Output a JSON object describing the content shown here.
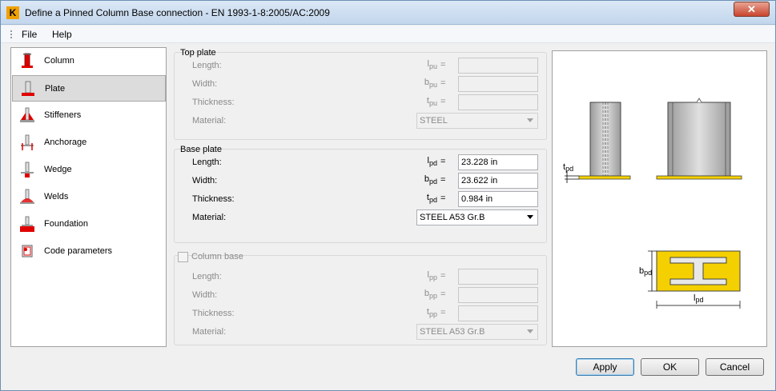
{
  "window": {
    "title": "Define a Pinned Column Base connection - EN 1993-1-8:2005/AC:2009",
    "app_icon": "K",
    "close_glyph": "✕"
  },
  "menu": {
    "file": "File",
    "help": "Help"
  },
  "nav": [
    {
      "label": "Column",
      "icon": "column-icon"
    },
    {
      "label": "Plate",
      "icon": "plate-icon",
      "selected": true
    },
    {
      "label": "Stiffeners",
      "icon": "stiffeners-icon"
    },
    {
      "label": "Anchorage",
      "icon": "anchorage-icon"
    },
    {
      "label": "Wedge",
      "icon": "wedge-icon"
    },
    {
      "label": "Welds",
      "icon": "welds-icon"
    },
    {
      "label": "Foundation",
      "icon": "foundation-icon"
    },
    {
      "label": "Code parameters",
      "icon": "code-parameters-icon"
    }
  ],
  "top_plate": {
    "title": "Top plate",
    "length_label": "Length:",
    "width_label": "Width:",
    "thickness_label": "Thickness:",
    "material_label": "Material:",
    "length_sym": "l",
    "length_sub": "pu",
    "width_sym": "b",
    "width_sub": "pu",
    "thickness_sym": "t",
    "thickness_sub": "pu",
    "eq": "=",
    "length_value": "",
    "width_value": "",
    "thickness_value": "",
    "material_value": "STEEL"
  },
  "base_plate": {
    "title": "Base plate",
    "length_label": "Length:",
    "width_label": "Width:",
    "thickness_label": "Thickness:",
    "material_label": "Material:",
    "length_sym": "l",
    "length_sub": "pd",
    "width_sym": "b",
    "width_sub": "pd",
    "thickness_sym": "t",
    "thickness_sub": "pd",
    "eq": "=",
    "length_value": "23.228 in",
    "width_value": "23.622 in",
    "thickness_value": "0.984 in",
    "material_value": "STEEL A53 Gr.B"
  },
  "column_base": {
    "title": "Column base",
    "checked": false,
    "length_label": "Length:",
    "width_label": "Width:",
    "thickness_label": "Thickness:",
    "material_label": "Material:",
    "length_sym": "l",
    "length_sub": "pp",
    "width_sym": "b",
    "width_sub": "pp",
    "thickness_sym": "t",
    "thickness_sub": "pp",
    "eq": "=",
    "length_value": "",
    "width_value": "",
    "thickness_value": "",
    "material_value": "STEEL A53 Gr.B"
  },
  "preview": {
    "t_sym": "t",
    "t_sub": "pd",
    "b_sym": "b",
    "b_sub": "pd",
    "l_sym": "l",
    "l_sub": "pd",
    "plate_color": "#f5d000",
    "column_color": "#c0c0c0"
  },
  "buttons": {
    "apply": "Apply",
    "ok": "OK",
    "cancel": "Cancel"
  }
}
